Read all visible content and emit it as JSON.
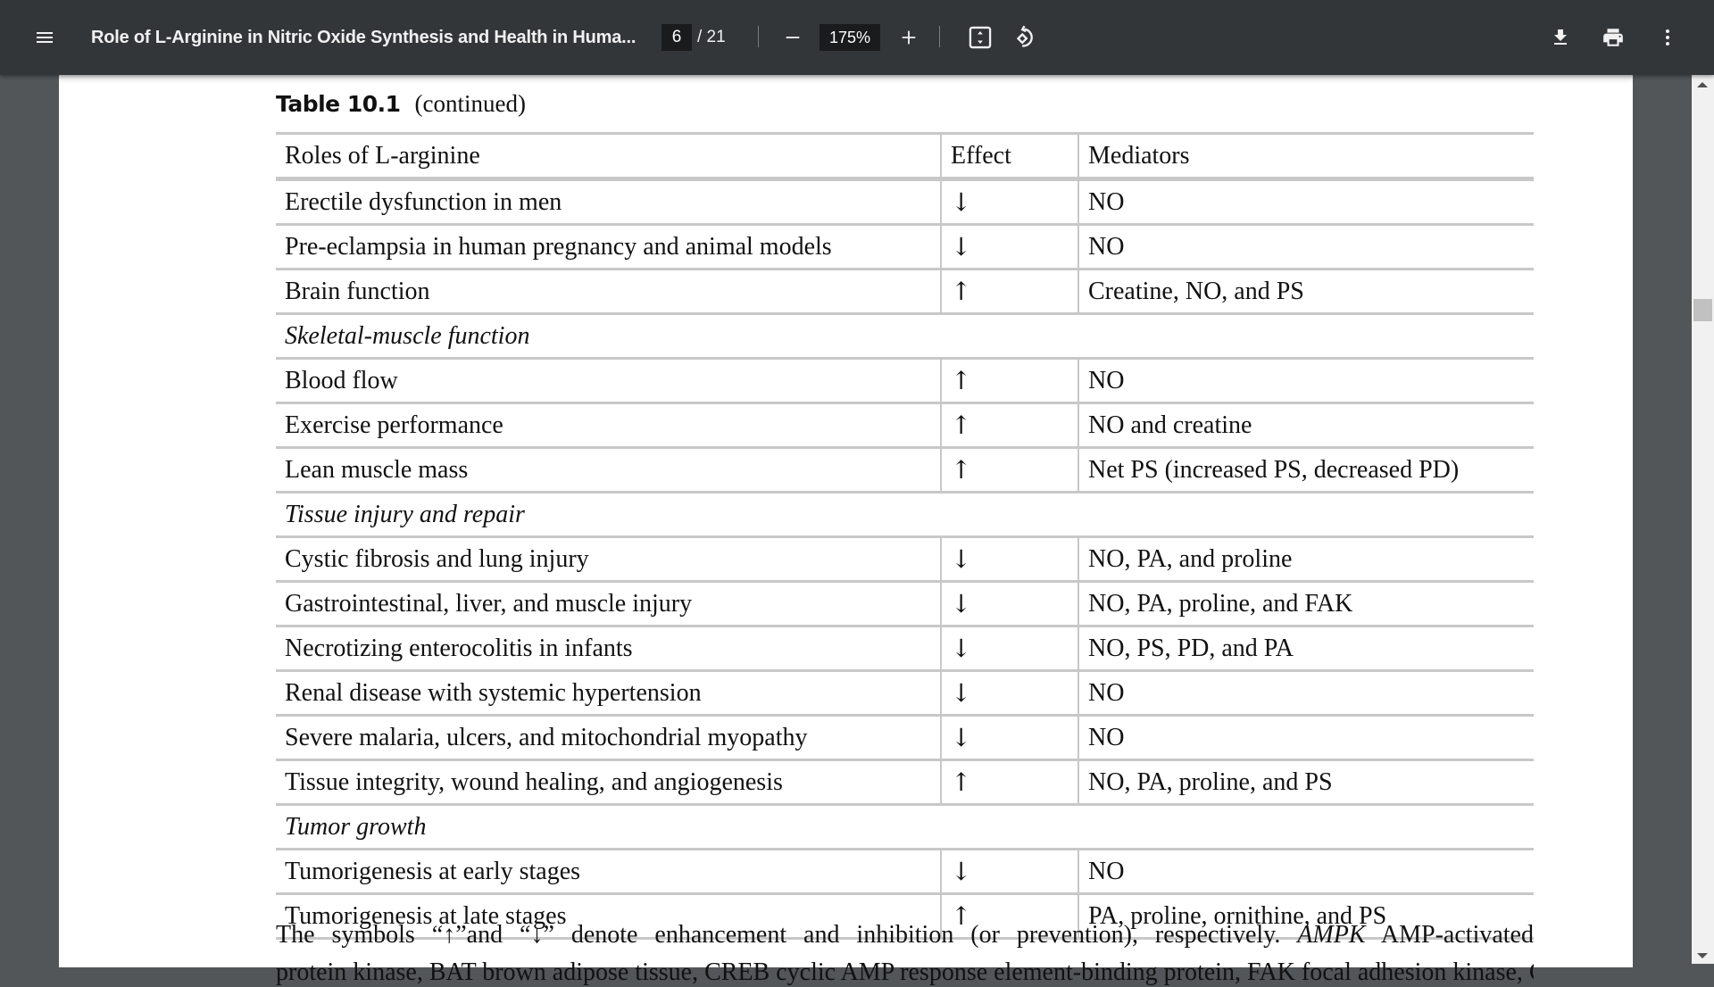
{
  "toolbar": {
    "menu_icon": "hamburger-menu-icon",
    "title": "Role of L-Arginine in Nitric Oxide Synthesis and Health in Huma...",
    "current_page": "6",
    "total_pages": "/ 21",
    "zoom_out_icon": "minus-icon",
    "zoom_level": "175%",
    "zoom_in_icon": "plus-icon",
    "fit_icon": "fit-to-page-icon",
    "rotate_icon": "rotate-counterclockwise-icon",
    "download_icon": "download-icon",
    "print_icon": "print-icon",
    "more_icon": "more-vertical-icon"
  },
  "document": {
    "caption_label": "Table 10.1",
    "caption_suffix": "(continued)",
    "table": {
      "headers": [
        "Roles of L-arginine",
        "Effect",
        "Mediators"
      ],
      "rows": [
        {
          "type": "data",
          "role": "Erectile dysfunction in men",
          "effect": "↓",
          "mediators": "NO"
        },
        {
          "type": "data",
          "role": "Pre-eclampsia in human pregnancy and animal models",
          "effect": "↓",
          "mediators": "NO"
        },
        {
          "type": "data",
          "role": "Brain function",
          "effect": "↑",
          "mediators": "Creatine, NO, and PS"
        },
        {
          "type": "section",
          "role": "Skeletal-muscle function"
        },
        {
          "type": "data",
          "role": "Blood flow",
          "effect": "↑",
          "mediators": "NO"
        },
        {
          "type": "data",
          "role": "Exercise performance",
          "effect": "↑",
          "mediators": "NO and creatine"
        },
        {
          "type": "data",
          "role": "Lean muscle mass",
          "effect": "↑",
          "mediators": "Net PS (increased PS, decreased PD)"
        },
        {
          "type": "section",
          "role": "Tissue injury and repair"
        },
        {
          "type": "data",
          "role": "Cystic fibrosis and lung injury",
          "effect": "↓",
          "mediators": "NO, PA, and proline"
        },
        {
          "type": "data",
          "role": "Gastrointestinal, liver, and muscle injury",
          "effect": "↓",
          "mediators": "NO, PA, proline, and FAK"
        },
        {
          "type": "data",
          "role": "Necrotizing enterocolitis in infants",
          "effect": "↓",
          "mediators": "NO, PS, PD, and PA"
        },
        {
          "type": "data",
          "role": "Renal disease with systemic hypertension",
          "effect": "↓",
          "mediators": "NO"
        },
        {
          "type": "data",
          "role": "Severe malaria, ulcers, and mitochondrial myopathy",
          "effect": "↓",
          "mediators": "NO"
        },
        {
          "type": "data",
          "role": "Tissue integrity, wound healing, and angiogenesis",
          "effect": "↑",
          "mediators": "NO, PA, proline, and PS"
        },
        {
          "type": "section",
          "role": "Tumor growth"
        },
        {
          "type": "data",
          "role": "Tumorigenesis at early stages",
          "effect": "↓",
          "mediators": "NO"
        },
        {
          "type": "data",
          "role": "Tumorigenesis at late stages",
          "effect": "↑",
          "mediators": "PA, proline, ornithine, and PS"
        }
      ]
    },
    "footnote_before_italic": "The symbols “↑”and “↓” denote enhancement and inhibition (or prevention), respectively. ",
    "footnote_italic": "AMPK",
    "footnote_after_italic": " AMP-activated",
    "footnote_line2_partial": "protein kinase, BAT brown adipose tissue, CREB cyclic AMP response element-binding protein, FAK focal adhesion kinase, GSH"
  },
  "scrollbar": {
    "up_icon": "scroll-up-arrow-icon",
    "down_icon": "scroll-down-arrow-icon"
  }
}
